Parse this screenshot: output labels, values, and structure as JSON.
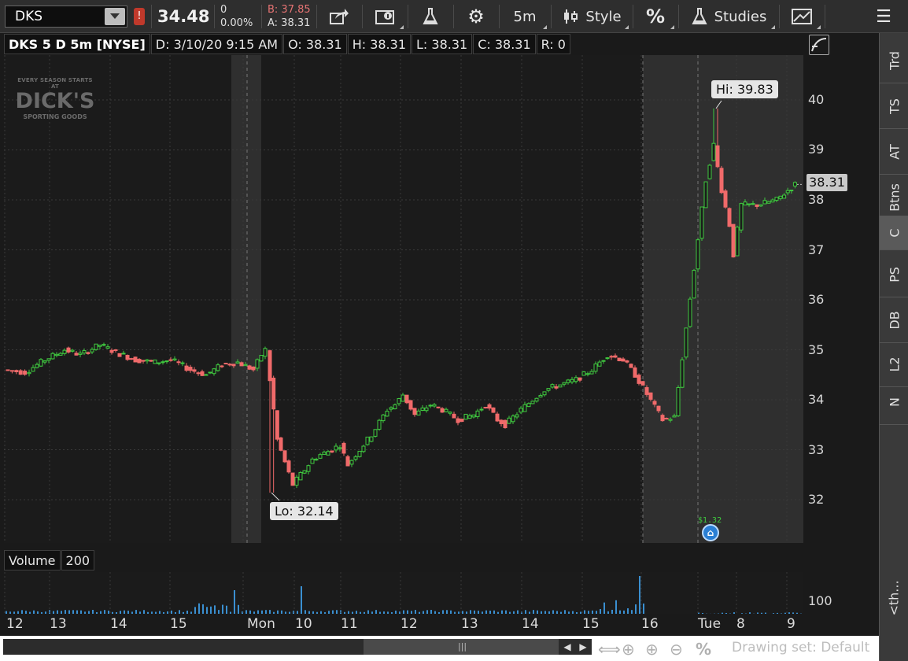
{
  "toolbar": {
    "symbol": "DKS",
    "alert_badge": "!",
    "last_price": "34.48",
    "net_change": "0",
    "pct_change": "0.00%",
    "bid": "B: 37.85",
    "ask": "A: 38.31",
    "timeframe": "5m",
    "style_label": "Style",
    "percent_label": "%",
    "studies_label": "Studies"
  },
  "chart_header": {
    "title": "DKS 5 D 5m [NYSE]",
    "date": "D: 3/10/20 9:15 AM",
    "open": "O: 38.31",
    "high": "H: 38.31",
    "low": "L: 38.31",
    "close": "C: 38.31",
    "range": "R: 0"
  },
  "logo": {
    "top_line": "EVERY SEASON STARTS AT",
    "brand": "DICK'S",
    "bottom_line": "SPORTING GOODS"
  },
  "annotations": {
    "high_label": "Hi: 39.83",
    "low_label": "Lo: 32.14",
    "event_value": "$1.32"
  },
  "price_axis": {
    "ticks": [
      "40",
      "39",
      "38",
      "37",
      "36",
      "35",
      "34",
      "33",
      "32"
    ],
    "last_tag": "38.31"
  },
  "volume": {
    "label": "Volume",
    "value": "200",
    "axis_tick": "100"
  },
  "time_axis": {
    "ticks": [
      "12",
      "13",
      "14",
      "15",
      "Mon",
      "10",
      "11",
      "12",
      "13",
      "14",
      "15",
      "16",
      "Tue",
      "8",
      "9"
    ]
  },
  "bottom_bar": {
    "drawing_set": "Drawing set: Default",
    "percent_icon": "%"
  },
  "sidebar": {
    "tabs": [
      "Trd",
      "TS",
      "AT",
      "Btns",
      "C",
      "PS",
      "DB",
      "L2",
      "N"
    ],
    "active": "C",
    "more": "<th..."
  },
  "colors": {
    "up": "#3fc93f",
    "down": "#f06a6a",
    "volume": "#3a8fd0",
    "background": "#1b1b1b",
    "extended_hours": "#2f2f2f"
  },
  "chart_data": {
    "type": "candlestick",
    "symbol": "DKS",
    "interval": "5m",
    "ylim": [
      31.5,
      40.8
    ],
    "high": 39.83,
    "low": 32.14,
    "last": 38.31,
    "approx_closes": [
      34.6,
      34.55,
      34.8,
      35.0,
      34.9,
      35.1,
      34.95,
      34.8,
      34.75,
      34.8,
      34.6,
      34.5,
      34.7,
      34.75,
      34.6,
      34.9,
      35.0,
      33.2,
      32.3,
      32.8,
      32.9,
      33.0,
      33.1,
      32.7,
      33.0,
      33.3,
      33.8,
      33.9,
      34.1,
      33.7,
      33.9,
      33.8,
      33.6,
      33.7,
      33.9,
      33.6,
      33.5,
      33.8,
      34.0,
      34.2,
      34.3,
      34.4,
      34.6,
      34.9,
      34.8,
      34.5,
      33.6,
      33.65,
      38.4,
      39.1,
      38.2,
      37.5,
      36.9,
      37.9,
      37.9,
      38.0,
      38.31
    ]
  }
}
